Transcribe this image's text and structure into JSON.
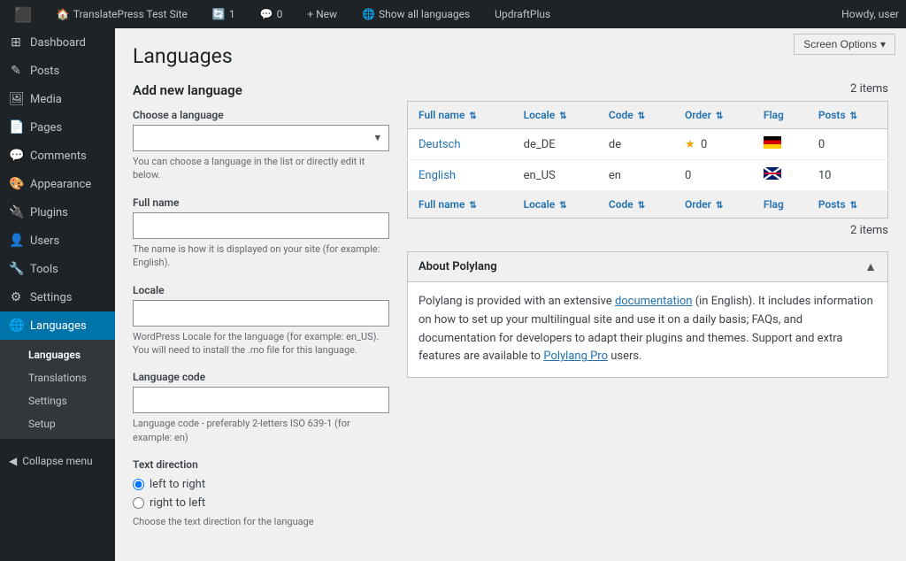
{
  "adminbar": {
    "wp_icon": "🅦",
    "site_name": "TranslatePress Test Site",
    "update_count": "1",
    "comment_count": "0",
    "new_label": "+ New",
    "show_all_languages": "Show all languages",
    "updraftplus": "UpdraftPlus",
    "howdy": "Howdy, user",
    "screen_options": "Screen Options"
  },
  "sidebar": {
    "items": [
      {
        "id": "dashboard",
        "label": "Dashboard",
        "icon": "⊞"
      },
      {
        "id": "posts",
        "label": "Posts",
        "icon": "✎"
      },
      {
        "id": "media",
        "label": "Media",
        "icon": "🖼"
      },
      {
        "id": "pages",
        "label": "Pages",
        "icon": "📄"
      },
      {
        "id": "comments",
        "label": "Comments",
        "icon": "💬"
      },
      {
        "id": "appearance",
        "label": "Appearance",
        "icon": "🎨"
      },
      {
        "id": "plugins",
        "label": "Plugins",
        "icon": "🔌"
      },
      {
        "id": "users",
        "label": "Users",
        "icon": "👤"
      },
      {
        "id": "tools",
        "label": "Tools",
        "icon": "🔧"
      },
      {
        "id": "settings",
        "label": "Settings",
        "icon": "⚙"
      }
    ],
    "languages_item": {
      "label": "Languages",
      "icon": "🌐"
    },
    "submenu": [
      {
        "id": "languages",
        "label": "Languages"
      },
      {
        "id": "translations",
        "label": "Translations"
      },
      {
        "id": "settings",
        "label": "Settings"
      },
      {
        "id": "setup",
        "label": "Setup"
      }
    ],
    "collapse_label": "Collapse menu"
  },
  "page": {
    "title": "Languages",
    "add_new_section": "Add new language",
    "choose_language_label": "Choose a language",
    "choose_language_hint": "You can choose a language in the list or directly edit it below.",
    "full_name_label": "Full name",
    "full_name_hint": "The name is how it is displayed on your site (for example: English).",
    "locale_label": "Locale",
    "locale_hint": "WordPress Locale for the language (for example: en_US). You will need to install the .mo file for this language.",
    "language_code_label": "Language code",
    "language_code_hint": "Language code - preferably 2-letters ISO 639-1 (for example: en)",
    "text_direction_label": "Text direction",
    "text_dir_ltr": "left to right",
    "text_dir_rtl": "right to left",
    "text_dir_hint": "Choose the text direction for the language"
  },
  "table": {
    "items_count": "2 items",
    "headers": [
      {
        "label": "Full name",
        "id": "fullname"
      },
      {
        "label": "Locale",
        "id": "locale"
      },
      {
        "label": "Code",
        "id": "code"
      },
      {
        "label": "Order",
        "id": "order"
      },
      {
        "label": "Flag",
        "id": "flag"
      },
      {
        "label": "Posts",
        "id": "posts"
      }
    ],
    "rows": [
      {
        "fullname": "Deutsch",
        "locale": "de_DE",
        "code": "de",
        "star": true,
        "order": "0",
        "flag": "de",
        "posts": "0"
      },
      {
        "fullname": "English",
        "locale": "en_US",
        "code": "en",
        "star": false,
        "order": "0",
        "flag": "en",
        "posts": "10"
      }
    ],
    "items_count_bottom": "2 items"
  },
  "polylang_box": {
    "title": "About Polylang",
    "content_1": "Polylang is provided with an extensive ",
    "doc_link_text": "documentation",
    "content_2": " (in English). It includes information on how to set up your multilingual site and use it on a daily basis; FAQs, and documentation for developers to adapt their plugins and themes. Support and extra features are available to ",
    "pro_link_text": "Polylang Pro",
    "content_3": " users."
  }
}
